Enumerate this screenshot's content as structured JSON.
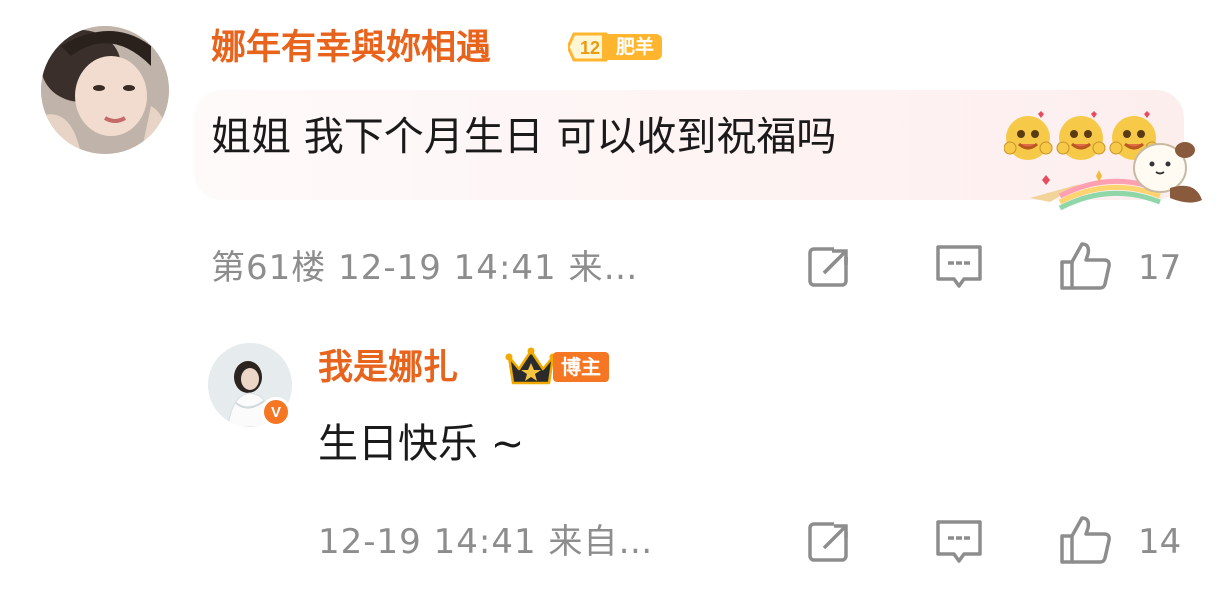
{
  "comment1": {
    "username": "娜年有幸與妳相遇",
    "fan_level": "12",
    "fan_label": "肥羊",
    "text": "姐姐 我下个月生日 可以收到祝福吗",
    "emoji_icons": [
      "hug-emoji-icon",
      "hug-emoji-icon",
      "hug-emoji-icon"
    ],
    "meta": "第61楼 12-19 14:41 来…",
    "likes": "17"
  },
  "reply1": {
    "username": "我是娜扎",
    "host_label": "博主",
    "verified_mark": "V",
    "text": "生日快乐 ~",
    "meta": "12-19 14:41 来自…",
    "likes": "14"
  },
  "colors": {
    "username": "#e8631b",
    "host_badge": "#f57623",
    "fan_badge": "#ffb52e",
    "meta_text": "#8d8d8d"
  }
}
